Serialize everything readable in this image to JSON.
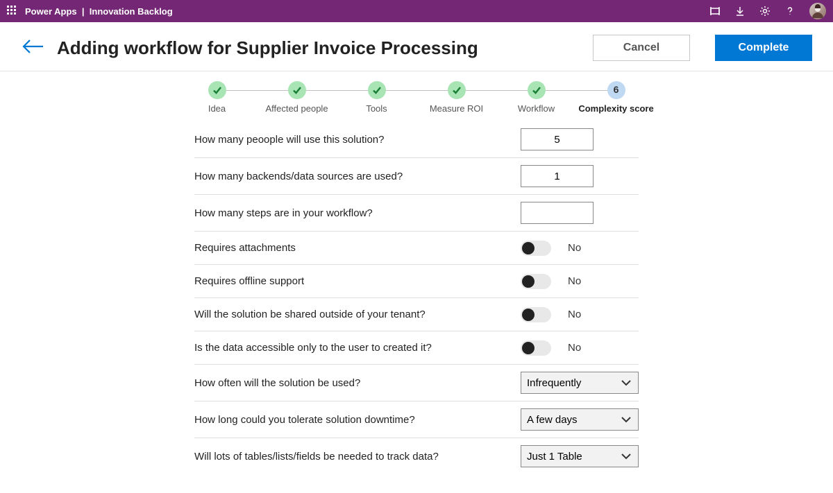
{
  "appbar": {
    "product": "Power Apps",
    "separator": "|",
    "app": "Innovation Backlog"
  },
  "header": {
    "title": "Adding workflow for Supplier Invoice Processing",
    "cancel": "Cancel",
    "complete": "Complete"
  },
  "steps": [
    {
      "label": "Idea",
      "done": true
    },
    {
      "label": "Affected people",
      "done": true
    },
    {
      "label": "Tools",
      "done": true
    },
    {
      "label": "Measure ROI",
      "done": true
    },
    {
      "label": "Workflow",
      "done": true
    },
    {
      "label": "Complexity score",
      "done": false,
      "active_number": "6"
    }
  ],
  "form": {
    "q_people": {
      "label": "How many peoople will use this solution?",
      "value": "5"
    },
    "q_backends": {
      "label": "How many backends/data sources are  used?",
      "value": "1"
    },
    "q_steps": {
      "label": "How many steps are in your workflow?",
      "value": ""
    },
    "q_attachments": {
      "label": "Requires attachments",
      "value_label": "No"
    },
    "q_offline": {
      "label": "Requires offline support",
      "value_label": "No"
    },
    "q_shared": {
      "label": "Will the solution be shared  outside of your tenant?",
      "value_label": "No"
    },
    "q_data_access": {
      "label": "Is the data accessible only to the user to created it?",
      "value_label": "No"
    },
    "q_frequency": {
      "label": "How often will the solution be used?",
      "value": "Infrequently"
    },
    "q_downtime": {
      "label": "How long could you tolerate solution downtime?",
      "value": "A few days"
    },
    "q_tables": {
      "label": "Will lots of tables/lists/fields be needed to track data?",
      "value": "Just 1 Table"
    }
  }
}
